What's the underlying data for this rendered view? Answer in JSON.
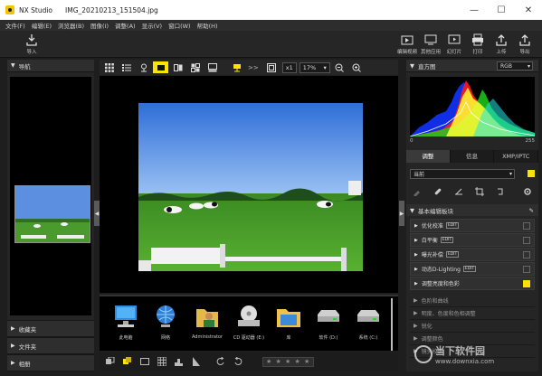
{
  "window": {
    "app_name": "NX Studio",
    "file_name": "IMG_20210213_151504.jpg",
    "minimize": "—",
    "maximize": "☐",
    "close": "✕"
  },
  "menu": [
    "文件(F)",
    "编辑(E)",
    "浏览器(B)",
    "图像(I)",
    "调整(A)",
    "显示(V)",
    "窗口(W)",
    "帮助(H)"
  ],
  "toolbar": {
    "import_label": "导入",
    "right_tools": [
      {
        "label": "编辑视频",
        "icon": "edit-video-icon"
      },
      {
        "label": "其他应用",
        "icon": "other-apps-icon"
      },
      {
        "label": "幻灯片",
        "icon": "slideshow-icon"
      },
      {
        "label": "打印",
        "icon": "print-icon"
      },
      {
        "label": "上传",
        "icon": "upload-icon"
      },
      {
        "label": "导出",
        "icon": "export-icon"
      }
    ]
  },
  "left_panel": {
    "navigation_title": "导航",
    "sections": [
      "收藏夹",
      "文件夹",
      "相册"
    ]
  },
  "viewer_toolbar": {
    "zoom_multiplier": "x1",
    "zoom_percent": "17%",
    "more": ">>"
  },
  "browser": {
    "items": [
      {
        "label": "此电脑",
        "icon": "computer-icon"
      },
      {
        "label": "网络",
        "icon": "network-icon"
      },
      {
        "label": "Administrator",
        "icon": "user-folder-icon"
      },
      {
        "label": "CD 驱动器 (E:)",
        "icon": "cd-drive-icon"
      },
      {
        "label": "库",
        "icon": "library-icon"
      },
      {
        "label": "软件 (D:)",
        "icon": "drive-icon"
      },
      {
        "label": "系统 (C:)",
        "icon": "drive-icon"
      }
    ]
  },
  "rating": "★ ★ ★ ★ ★",
  "right_panel": {
    "histogram_title": "直方图",
    "channel": "RGB",
    "scale_min": "0",
    "scale_max": "255",
    "tabs": [
      "调整",
      "信息",
      "XMP/IPTC"
    ],
    "active_tab": 0,
    "preset": "当前",
    "basic_tools_title": "基本编辑板块",
    "adjustments": [
      {
        "label": "优化校准",
        "tag": "EDIT",
        "checked": false
      },
      {
        "label": "白平衡",
        "tag": "EDIT",
        "checked": false
      },
      {
        "label": "曝光补偿",
        "tag": "EDIT",
        "checked": false
      },
      {
        "label": "动态D-Lighting",
        "tag": "EDIT",
        "checked": false
      },
      {
        "label": "调整亮度和色彩",
        "tag": "",
        "checked": true
      }
    ],
    "more_sections": [
      "色阶和曲线",
      "明度、色度和色相调整",
      "锐化",
      "调整颜色",
      "镜头校正"
    ]
  },
  "watermark": {
    "cn": "当下软件园",
    "url": "www.downxia.com"
  },
  "colors": {
    "accent": "#fce300",
    "panel_bg": "#252525",
    "titlebar_bg": "#ffffff"
  }
}
